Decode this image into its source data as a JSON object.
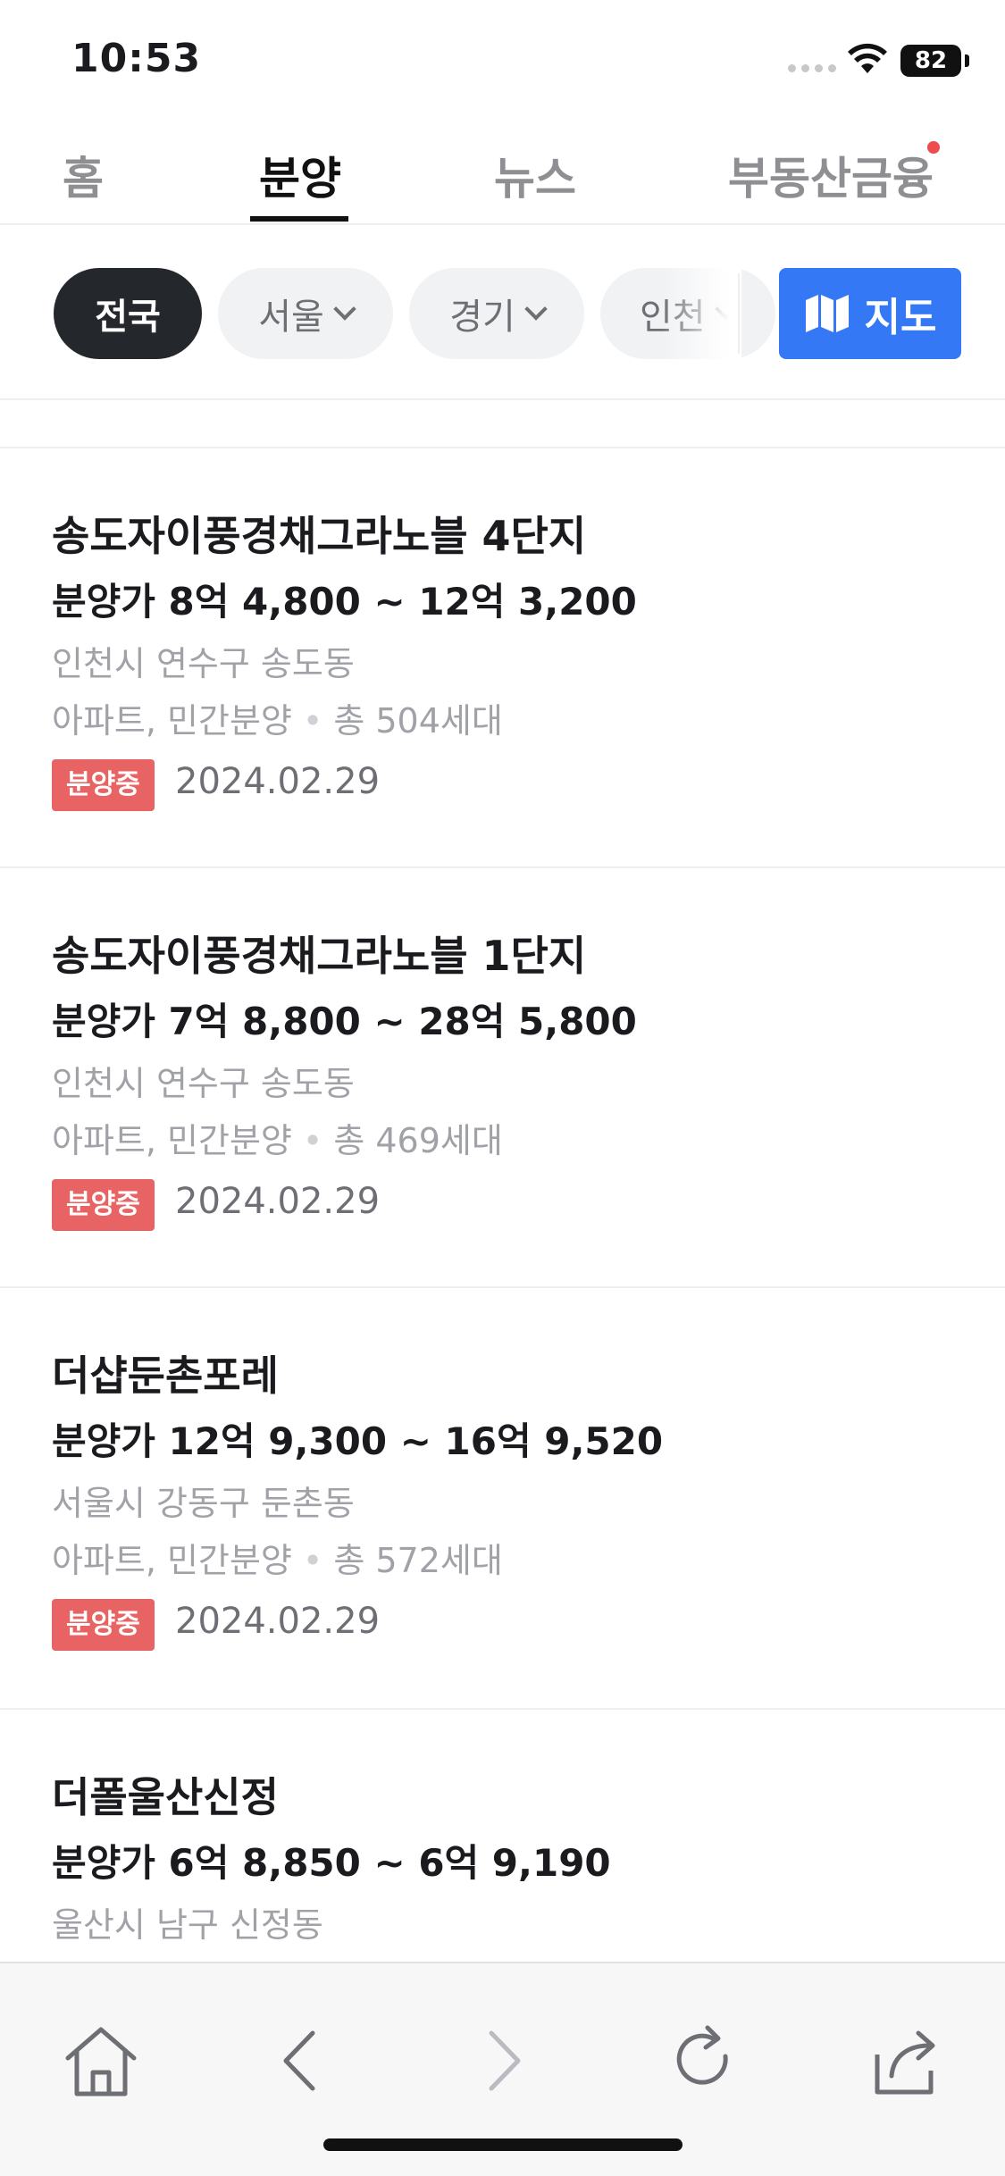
{
  "status": {
    "time": "10:53",
    "battery": "82"
  },
  "tabs": [
    {
      "label": "홈",
      "active": false
    },
    {
      "label": "분양",
      "active": true
    },
    {
      "label": "뉴스",
      "active": false
    },
    {
      "label": "부동산금융",
      "active": false,
      "has_dot": true
    }
  ],
  "regions": [
    {
      "label": "전국",
      "active": true
    },
    {
      "label": "서울",
      "active": false
    },
    {
      "label": "경기",
      "active": false
    },
    {
      "label": "인천",
      "active": false
    }
  ],
  "map_button": {
    "label": "지도",
    "color": "#3478f6"
  },
  "listings": [
    {
      "name": "송도자이풍경채그라노블 4단지",
      "price": "분양가 8억 4,800 ~ 12억 3,200",
      "address": "인천시 연수구 송도동",
      "type": "아파트, 민간분양",
      "households": "총 504세대",
      "status": "분양중",
      "date": "2024.02.29"
    },
    {
      "name": "송도자이풍경채그라노블 1단지",
      "price": "분양가 7억 8,800 ~ 28억 5,800",
      "address": "인천시 연수구 송도동",
      "type": "아파트, 민간분양",
      "households": "총 469세대",
      "status": "분양중",
      "date": "2024.02.29"
    },
    {
      "name": "더샵둔촌포레",
      "price": "분양가 12억 9,300 ~ 16억 9,520",
      "address": "서울시 강동구 둔촌동",
      "type": "아파트, 민간분양",
      "households": "총 572세대",
      "status": "분양중",
      "date": "2024.02.29"
    },
    {
      "name": "더폴울산신정",
      "price": "분양가 6억 8,850 ~ 6억 9,190",
      "address": "울산시 남구 신정동"
    }
  ],
  "colors": {
    "badge": "#e86464",
    "accent": "#3478f6",
    "dot": "#ee4d4d"
  },
  "toolbar_icons": [
    "home-icon",
    "back-icon",
    "forward-icon",
    "reload-icon",
    "share-icon"
  ]
}
